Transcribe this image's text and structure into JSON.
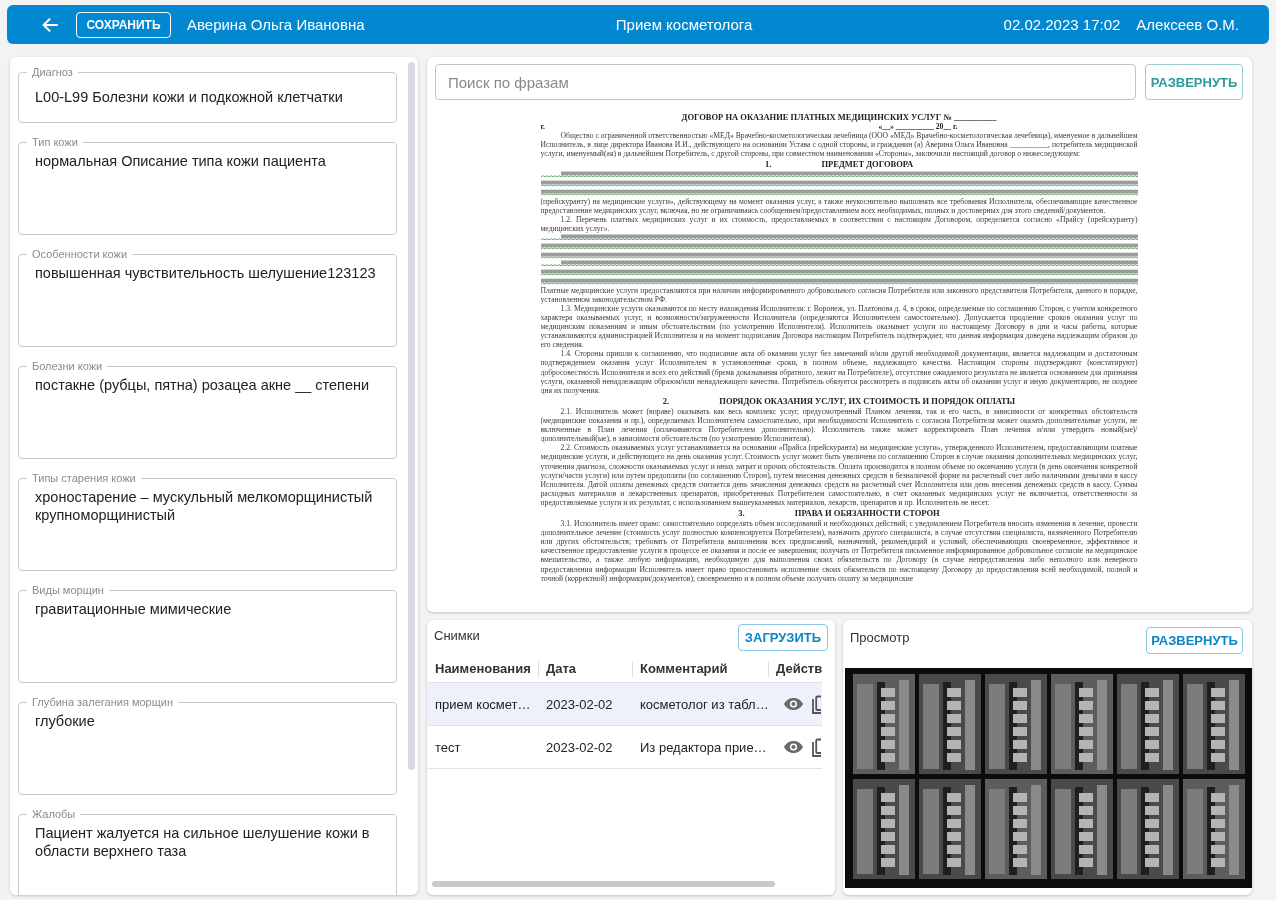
{
  "header": {
    "save_button": "СОХРАНИТЬ",
    "patient": "Аверина Ольга Ивановна",
    "title": "Прием косметолога",
    "datetime": "02.02.2023 17:02",
    "doctor": "Алексеев О.М."
  },
  "form": {
    "fields": [
      {
        "kind": "single",
        "label": "Диагноз",
        "value": "L00-L99 Болезни кожи и подкожной клетчатки"
      },
      {
        "kind": "multi",
        "label": "Тип кожи",
        "value": "нормальная Описание типа кожи пациента"
      },
      {
        "kind": "multi",
        "label": "Особенности кожи",
        "value": "повышенная чувствительность шелушение123123"
      },
      {
        "kind": "multi",
        "label": "Болезни кожи",
        "value": "постакне (рубцы, пятна) розацеа акне __ степени"
      },
      {
        "kind": "multi",
        "label": "Типы старения кожи",
        "value": "хроностарение – мускульный мелкоморщинистый крупноморщинистый"
      },
      {
        "kind": "multi",
        "label": "Виды морщин",
        "value": "гравитационные мимические"
      },
      {
        "kind": "multi",
        "label": "Глубина залегания морщин",
        "value": "глубокие"
      },
      {
        "kind": "multi",
        "label": "Жалобы",
        "value": "Пациент жалуется на сильное шелушение кожи в области верхнего таза"
      }
    ]
  },
  "document": {
    "search_placeholder": "Поиск по фразам",
    "expand_button": "РАЗВЕРНУТЬ",
    "blocks": [
      {
        "kind": "title",
        "text": "ДОГОВОР НА ОКАЗАНИЕ ПЛАТНЫХ МЕДИЦИНСКИХ УСЛУГ № __________"
      },
      {
        "kind": "dateline",
        "left": "г.",
        "right": "«__» __________ 20__ г."
      },
      {
        "kind": "paragraph",
        "text": "Общество с ограниченной ответственностью «МЕД» Врачебно-косметологическая лечебница (ООО «МЕД» Врачебно-косметологическая лечебница), именуемое в дальнейшем Исполнитель, в лице директора Иванова И.И., действующего на основании Устава с одной стороны, и гражданин (а) Аверина Ольга Ивановна __________, потребитель медицинской услуги, именуемый(ая) в дальнейшем Потребитель, с другой стороны, при совместном наименовании «Стороны», заключили настоящий договор о нижеследующем:"
      },
      {
        "kind": "heading",
        "number": "1.",
        "text": "ПРЕДМЕТ ДОГОВОРА"
      },
      {
        "kind": "illegible"
      },
      {
        "kind": "continuation",
        "text": "(прейскуранту) на медицинские услуги», действующему на момент оказания услуг, а также неукоснительно выполнять все требования Исполнителя, обеспечивающие качественное предоставление медицинских услуг, включая, но не ограничиваясь сообщением/предоставлением всех необходимых, полных и достоверных для этого сведений/документов."
      },
      {
        "kind": "paragraph",
        "text": "1.2. Перечень платных медицинских услуг и их стоимость, предоставляемых в соответствии с настоящим Договором, определяется согласно «Прайсу (прейскуранту) медицинских услуг»."
      },
      {
        "kind": "illegible"
      },
      {
        "kind": "illegible"
      },
      {
        "kind": "continuation",
        "text": "Платные медицинские услуги предоставляются при наличии информированного добровольного согласия Потребителя или законного представителя Потребителя, данного в порядке, установленном законодательством РФ."
      },
      {
        "kind": "paragraph",
        "text": "1.3. Медицинские услуги оказываются по месту нахождения Исполнителя: г. Воронеж, ул. Платонова д. 4, в сроки, определяемые по соглашению Сторон, с учетом конкретного характера оказываемых услуг, и возможности/загруженности Исполнителя (определяются Исполнителем самостоятельно). Допускается продление сроков оказания услуг по медицинским показаниям и иным обстоятельствам (по усмотрению Исполнителя). Исполнитель оказывает услуги по настоящему Договору в дни и часы работы, которые устанавливаются администрацией Исполнителя и на момент подписания Договора настоящим Потребитель подтверждает, что данная информация доведена надлежащим образом до его сведения."
      },
      {
        "kind": "paragraph",
        "text": "1.4. Стороны пришли к соглашению, что подписание акта об оказании услуг без замечаний и/или другой необходимой документации, является надлежащим и достаточным подтверждением оказания услуг Исполнителем в установленные сроки, в полном объеме, надлежащего качества. Настоящим стороны подтверждают (констатируют) добросовестность Исполнителя и всех его действий (бремя доказывания обратного, лежит на Потребителе), отсутствие ожидаемого результата не является основанием для признания услуги, оказанной ненадлежащим образом/или ненадлежащего качества. Потребитель обязуется рассмотреть и подписать акты об оказании услуг и иную документацию, не позднее дня их получения."
      },
      {
        "kind": "heading",
        "number": "2.",
        "text": "ПОРЯДОК ОКАЗАНИЯ УСЛУГ, ИХ СТОИМОСТЬ И ПОРЯДОК ОПЛАТЫ"
      },
      {
        "kind": "paragraph",
        "text": "2.1. Исполнитель может (вправе) оказывать как весь комплекс услуг, предусмотренный Планом лечения, так и его часть, в зависимости от конкретных обстоятельств (медицинские показания и пр.), определяемых Исполнителем самостоятельно, при необходимости Исполнитель с согласия Потребителя может оказать дополнительные услуги, не включенные в План лечения (оплачиваются Потребителем дополнительно). Исполнитель также может корректировать План лечения и/или утвердить новый(ые)/дополнительный(ые), в зависимости обстоятельств (по усмотрению Исполнителя)."
      },
      {
        "kind": "paragraph",
        "text": "2.2. Стоимость оказываемых услуг устанавливается на основании «Прайса (прейскуранта) на медицинские услуги», утвержденного Исполнителем, предоставляющим платные медицинские услуги, и действующего на день оказания услуг. Стоимость услуг может быть увеличена по соглашению Сторон в случае оказания дополнительных медицинских услуг, уточнения диагноза, сложности оказываемых услуг и иных затрат и прочих обстоятельств. Оплата производится в полном объеме по окончанию услуги (в день окончания конкретной услуги/части услуги) или путем предоплаты (по соглашению Сторон), путем внесения денежных средств в безналичной форме на расчетный счет либо наличными деньгами в кассу Исполнителя. Датой оплаты денежных средств считается день зачисления денежных средств на расчетный счет Исполнителя или день внесения денежных средств в кассу. Суммы расходных материалов и лекарственных препаратов, приобретенных Потребителем самостоятельно, в счет оказанных медицинских услуг не включается, ответственности за предоставляемые услуги и их результат, с использованием вышеуказанных материалов, лекарств, препаратов и пр. Исполнитель не несет."
      },
      {
        "kind": "heading",
        "number": "3.",
        "text": "ПРАВА И ОБЯЗАННОСТИ СТОРОН"
      },
      {
        "kind": "paragraph",
        "text": "3.1. Исполнитель имеет право: самостоятельно определять объем исследований и необходимых действий; с уведомлением Потребителя вносить изменения в лечение, провести дополнительное лечение (стоимость услуг полностью компенсируется Потребителем), назначить другого специалиста, в случае отсутствия специалиста, назначенного Потребителю или других обстоятельств; требовать от Потребителя выполнения всех предписаний, назначений, рекомендаций и условий, обеспечивающих своевременное, эффективное и качественное предоставление услуги в процессе ее оказания и после ее завершения; получать от Потребителя письменное информированное добровольное согласие на медицинское вмешательство, а также любую информацию, необходимую для выполнения своих обязательств по Договору (в случае непредставления либо неполного или неверного предоставления информации Исполнитель имеет право приостановить исполнение своих обязательств по настоящему Договору до предоставления всей необходимой, полной и точной (корректной) информации/документов); своевременно и в полном объеме получать оплату за медицинские"
      }
    ]
  },
  "photos": {
    "title": "Снимки",
    "upload_button": "ЗАГРУЗИТЬ",
    "columns": [
      "Наименования",
      "Дата",
      "Комментарий",
      "Действ"
    ],
    "rows": [
      {
        "name": "прием космет…",
        "date": "2023-02-02",
        "comment": "косметолог из табл…",
        "selected": true
      },
      {
        "name": "тест",
        "date": "2023-02-02",
        "comment": "Из редактора прие…",
        "selected": false
      }
    ]
  },
  "preview": {
    "title": "Просмотр",
    "expand_button": "РАЗВЕРНУТЬ"
  }
}
